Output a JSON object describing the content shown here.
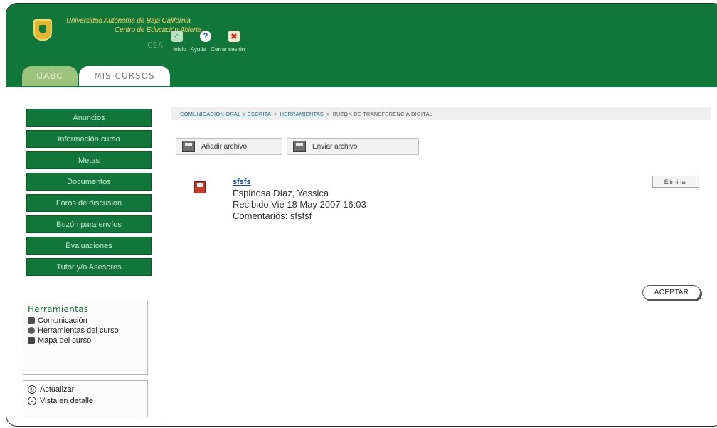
{
  "header": {
    "university_line1": "Universidad Autónoma de Baja California",
    "university_line2": "Centro de Educación Abierta",
    "cea_logo": "CEA",
    "nav": {
      "home_label": "Inicio",
      "help_label": "Ayuda",
      "logout_label": "Cerrar sesión"
    },
    "tabs": [
      {
        "label": "UABC"
      },
      {
        "label": "MIS CURSOS"
      }
    ]
  },
  "sidebar": {
    "buttons": [
      {
        "label": "Anuncios"
      },
      {
        "label": "Información curso"
      },
      {
        "label": "Metas"
      },
      {
        "label": "Documentos"
      },
      {
        "label": "Foros de discusión"
      },
      {
        "label": "Buzón para envíos"
      },
      {
        "label": "Evaluaciones"
      },
      {
        "label": "Tutor y/o Asesores"
      }
    ],
    "tools": {
      "title": "Herramientas",
      "items": [
        {
          "label": "Comunicación",
          "icon": "chat-icon"
        },
        {
          "label": "Herramientas del curso",
          "icon": "tools-icon"
        },
        {
          "label": "Mapa del curso",
          "icon": "map-icon"
        }
      ]
    },
    "actions": [
      {
        "label": "Actualizar",
        "icon": "refresh-icon"
      },
      {
        "label": "Vista en detalle",
        "icon": "detail-view-icon"
      }
    ]
  },
  "main": {
    "breadcrumb": {
      "link1": "COMUNICACIÓN ORAL Y ESCRITA",
      "sep1": ">",
      "link2": "HERRAMIENTAS",
      "sep2": ">",
      "current": "BUZÓN DE TRANSFERENCIA DIGITAL"
    },
    "toolbar": {
      "add_file": "Añadir archivo",
      "send_file": "Enviar archivo"
    },
    "file": {
      "name": "sfsfs",
      "author": "Espinosa Díaz, Yessica",
      "received": "Recibido Vie 18 May 2007 16:03",
      "comments": "Comentarios: sfsfsf"
    },
    "delete_label": "Eliminar",
    "accept_label": "ACEPTAR"
  }
}
